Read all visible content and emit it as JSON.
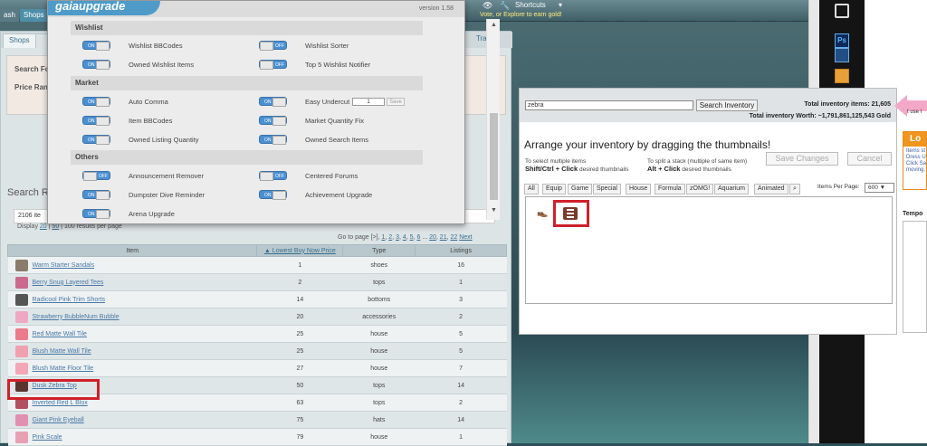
{
  "topbar": {
    "left_tab": "ash",
    "shops_tab": "Shops",
    "message": "Vote, or Explore to earn gold!",
    "shortcuts": "Shortcuts"
  },
  "shop": {
    "tab_shops": "Shops",
    "tab_trade": "Trade",
    "search_for_label": "Search Fo",
    "price_range_label": "Price Rang",
    "results_title": "Search Re",
    "results_count": "2106 ite",
    "display_prefix": "Display",
    "display_20": "20",
    "display_50": "50",
    "display_suffix": "100 results per page",
    "pager_prefix": "Go to page",
    "pager_pages": [
      "[>]",
      "1",
      "2",
      "3",
      "4",
      "5",
      "6",
      "...",
      "20",
      "21",
      "22",
      "Next"
    ],
    "columns": {
      "item": "Item",
      "price": "Lowest Buy Now Price",
      "type": "Type",
      "listings": "Listings"
    },
    "rows": [
      {
        "name": "Warm Starter Sandals",
        "price": "1",
        "type": "shoes",
        "listings": "16",
        "color": "#8a7b6a"
      },
      {
        "name": "Berry Snug Layered Tees",
        "price": "2",
        "type": "tops",
        "listings": "1",
        "color": "#c96a8a"
      },
      {
        "name": "Radicool Pink Trim Shorts",
        "price": "14",
        "type": "bottoms",
        "listings": "3",
        "color": "#555555"
      },
      {
        "name": "Strawberry BubbleNum Bubble",
        "price": "20",
        "type": "accessories",
        "listings": "2",
        "color": "#f0a8c0"
      },
      {
        "name": "Red Matte Wall Tile",
        "price": "25",
        "type": "house",
        "listings": "5",
        "color": "#ec7a8a"
      },
      {
        "name": "Blush Matte Wall Tile",
        "price": "25",
        "type": "house",
        "listings": "5",
        "color": "#f0a0b0"
      },
      {
        "name": "Blush Matte Floor Tile",
        "price": "27",
        "type": "house",
        "listings": "7",
        "color": "#f2a6b6"
      },
      {
        "name": "Dusk Zebra Top",
        "price": "50",
        "type": "tops",
        "listings": "14",
        "color": "#5a3530"
      },
      {
        "name": "Inverted Red L Blox",
        "price": "63",
        "type": "tops",
        "listings": "2",
        "color": "#b05060"
      },
      {
        "name": "Giant Pink Eyeball",
        "price": "75",
        "type": "hats",
        "listings": "14",
        "color": "#e090b0"
      },
      {
        "name": "Pink Scale",
        "price": "79",
        "type": "house",
        "listings": "1",
        "color": "#e6a0b2"
      }
    ]
  },
  "upgrade": {
    "logo": "gaiaupgrade",
    "version": "version 1.58",
    "sections": {
      "wishlist": "Wishlist",
      "market": "Market",
      "others": "Others"
    },
    "options": {
      "wishlist_bbcodes": "Wishlist BBCodes",
      "wishlist_sorter": "Wishlist Sorter",
      "owned_wishlist_items": "Owned Wishlist Items",
      "top5_wishlist_notifier": "Top 5 Wishlist Notifier",
      "auto_comma": "Auto Comma",
      "easy_undercut": "Easy Undercut",
      "item_bbcodes": "Item BBCodes",
      "market_quantity_fix": "Market Quantity Fix",
      "owned_listing_quantity": "Owned Listing Quantity",
      "owned_search_items": "Owned Search Items",
      "announcement_remover": "Announcement Remover",
      "centered_forums": "Centered Forums",
      "dumpster_dive_reminder": "Dumpster Dive Reminder",
      "achievement_upgrade": "Achievement Upgrade",
      "arena_upgrade": "Arena Upgrade"
    },
    "toggle_on": "ON",
    "toggle_off": "OFF",
    "undercut_value": "1",
    "save_label": "Save"
  },
  "inventory": {
    "search_value": "zebra",
    "search_button": "Search Inventory",
    "total_items": "Total inventory items: 21,605",
    "total_worth": "Total inventory Worth: ~1,791,861,125,543 Gold",
    "title": "Arrange your inventory by dragging the thumbnails!",
    "hint_select_1": "To select multiple items",
    "hint_select_2": "Shift/Ctrl + Click",
    "hint_select_3": "desired thumbnails",
    "hint_split_1": "To split a stack (multiple of same item)",
    "hint_split_2": "Alt + Click",
    "hint_split_3": "desired thumbnails",
    "save_changes": "Save Changes",
    "cancel": "Cancel",
    "tabs": [
      "All",
      "Equip",
      "Game",
      "Special",
      "House",
      "Formula",
      "zOMG!",
      "Aquarium",
      "Animated"
    ],
    "items_per_page_label": "Items Per Page:",
    "items_per_page_value": "600"
  },
  "right_panel": {
    "header": "Lo",
    "lines": [
      "Items st",
      "Dress U",
      "Click Sa",
      "moving."
    ],
    "tempo": "Tempo",
    "side_text": "t use I"
  }
}
